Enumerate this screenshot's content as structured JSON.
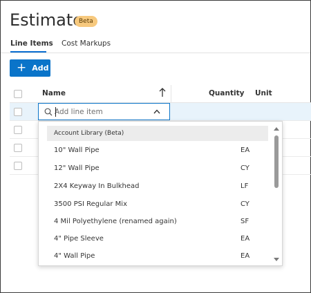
{
  "page": {
    "title": "Estimate",
    "badge": "Beta"
  },
  "tabs": [
    {
      "label": "Line Items",
      "active": true
    },
    {
      "label": "Cost Markups",
      "active": false
    }
  ],
  "toolbar": {
    "add_label": "Add"
  },
  "table": {
    "columns": {
      "name": "Name",
      "quantity": "Quantity",
      "unit": "Unit"
    }
  },
  "search": {
    "placeholder": "Add line item",
    "value": ""
  },
  "dropdown": {
    "section_label": "Account Library (Beta)",
    "items": [
      {
        "name": "10\" Wall Pipe",
        "unit": "EA"
      },
      {
        "name": "12\" Wall Pipe",
        "unit": "CY"
      },
      {
        "name": "2X4 Keyway In Bulkhead",
        "unit": "LF"
      },
      {
        "name": "3500 PSI Regular Mix",
        "unit": "CY"
      },
      {
        "name": "4 Mil Polyethylene (renamed again)",
        "unit": "SF"
      },
      {
        "name": "4\" Pipe Sleeve",
        "unit": "EA"
      },
      {
        "name": "4\" Wall Pipe",
        "unit": "EA"
      }
    ]
  },
  "colors": {
    "accent": "#0a74c9",
    "badge_bg": "#f7c97e",
    "row_highlight": "#e8f3fb"
  }
}
